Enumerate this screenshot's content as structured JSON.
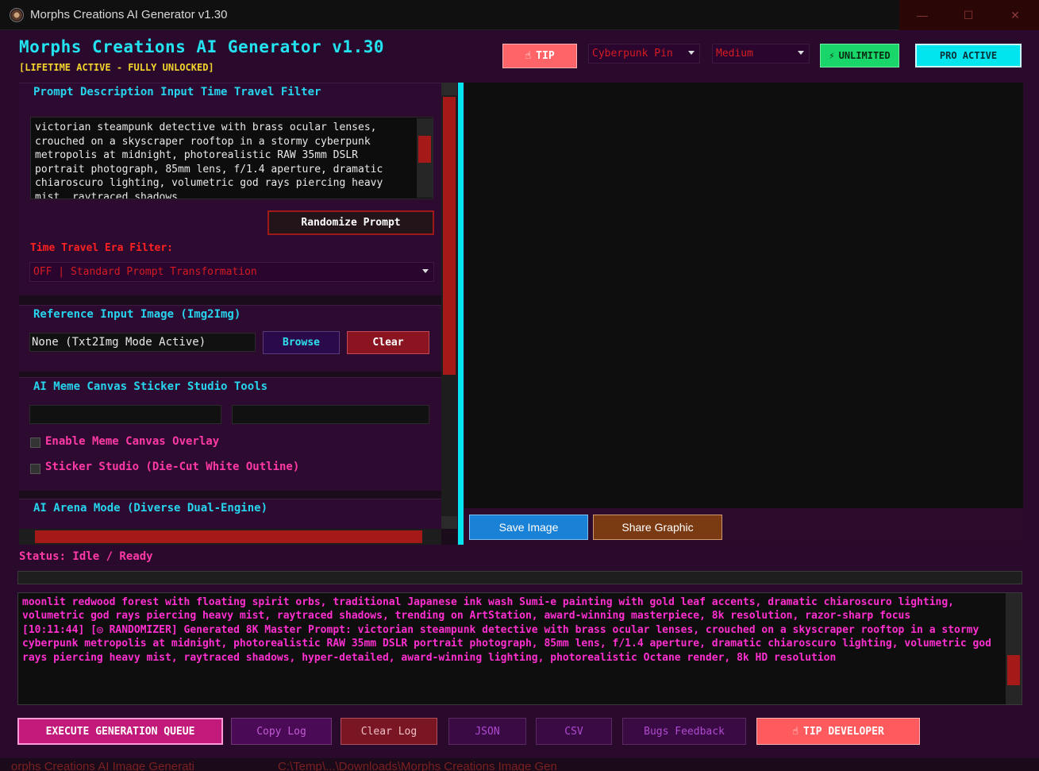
{
  "window": {
    "title": "Morphs Creations AI Generator v1.30",
    "controls": [
      "—",
      "☐",
      "✕"
    ]
  },
  "header": {
    "title": "Morphs Creations AI Generator v1.30",
    "subtitle": "[LIFETIME ACTIVE - FULLY UNLOCKED]",
    "tip_label": "TIP",
    "style_dropdown": "Cyberpunk Pin",
    "quality_dropdown": "Medium",
    "unlimited_label": "UNLIMITED",
    "pro_label": "PRO ACTIVE"
  },
  "prompt_group": {
    "title": "Prompt Description Input  Time Travel Filter",
    "text": "victorian steampunk detective with brass ocular lenses, crouched on a skyscraper rooftop in a stormy cyberpunk metropolis at midnight, photorealistic RAW 35mm DSLR portrait photograph, 85mm lens, f/1.4 aperture, dramatic chiaroscuro lighting, volumetric god rays piercing heavy mist, raytraced shadows",
    "randomize_label": "Randomize Prompt",
    "era_label": "Time Travel Era Filter:",
    "era_value": "OFF | Standard Prompt Transformation"
  },
  "reference_group": {
    "title": "Reference Input Image (Img2Img)",
    "field_value": "None (Txt2Img Mode Active)",
    "browse_label": "Browse",
    "clear_label": "Clear"
  },
  "meme_group": {
    "title": "AI Meme Canvas Sticker Studio Tools",
    "overlay_label": "Enable Meme Canvas Overlay",
    "sticker_label": "Sticker Studio (Die-Cut White Outline)"
  },
  "arena_group": {
    "title": "AI Arena Mode (Diverse Dual-Engine)"
  },
  "canvas": {
    "save_label": "Save Image",
    "share_label": "Share Graphic"
  },
  "status": "Status: Idle / Ready",
  "log": "moonlit redwood forest with floating spirit orbs, traditional Japanese ink wash Sumi-e painting with gold leaf accents, dramatic chiaroscuro lighting, volumetric god rays piercing heavy mist, raytraced shadows, trending on ArtStation, award-winning masterpiece, 8k resolution, razor-sharp focus\n[10:11:44] [◎ RANDOMIZER] Generated 8K Master Prompt: victorian steampunk detective with brass ocular lenses, crouched on a skyscraper rooftop in a stormy cyberpunk metropolis at midnight, photorealistic RAW 35mm DSLR portrait photograph, 85mm lens, f/1.4 aperture, dramatic chiaroscuro lighting, volumetric god rays piercing heavy mist, raytraced shadows, hyper-detailed, award-winning lighting, photorealistic Octane render, 8k HD resolution",
  "bottom_buttons": {
    "execute": "EXECUTE GENERATION QUEUE",
    "copy_log": "Copy Log",
    "clear_log": "Clear Log",
    "json": "JSON",
    "csv": "CSV",
    "bugs": "Bugs Feedback",
    "tip_dev": "TIP DEVELOPER"
  },
  "background_taskbar": {
    "left_text": "orphs Creations AI Image Generati",
    "right_text": "C:\\Temp\\...\\Downloads\\Morphs Creations Image Gen"
  },
  "colors": {
    "accent_cyan": "#00e5ee",
    "accent_pink": "#ff3aa6",
    "accent_red": "#a51919",
    "bg_purple": "#2a0a2c"
  }
}
